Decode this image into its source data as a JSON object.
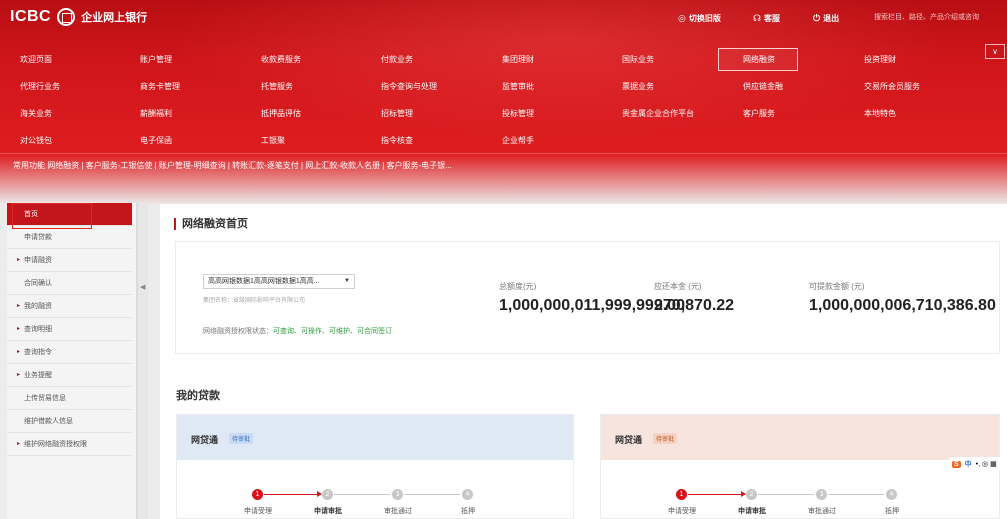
{
  "header": {
    "brand": "ICBC",
    "brand_sub": "企业网上银行",
    "switch_version": "切换旧版",
    "customer_service": "客服",
    "logout": "退出",
    "search_placeholder": "搜索栏目、路径、产品介绍或咨询"
  },
  "menu": [
    [
      "欢迎页面",
      "账户管理",
      "收款费服务",
      "付款业务",
      "集团理财",
      "国际业务",
      "网络融资",
      "投资理财"
    ],
    [
      "代理行业务",
      "商务卡管理",
      "托管服务",
      "指令查询与处理",
      "监管审批",
      "票据业务",
      "供应链金融",
      "交易所会员服务"
    ],
    [
      "海关业务",
      "薪酬福利",
      "抵押品评估",
      "招标管理",
      "投标管理",
      "贵金属企业合作平台",
      "客户服务",
      "本地特色"
    ],
    [
      "对公钱包",
      "电子保函",
      "工银聚",
      "指令核查",
      "企业帮手"
    ]
  ],
  "menu_toggle": "∨",
  "quickbar": "常用功能  网络融资 | 客户服务-工银信使 | 账户管理-明细查询 | 转账汇款-逐笔支付 | 网上汇款-收款人名册 | 客户服务-电子银...",
  "sidebar": {
    "items": [
      {
        "label": "首页",
        "active": true,
        "arrow": false
      },
      {
        "label": "申请贷款",
        "arrow": false
      },
      {
        "label": "申请融资",
        "arrow": true
      },
      {
        "label": "合同确认",
        "arrow": false
      },
      {
        "label": "我的融资",
        "arrow": true
      },
      {
        "label": "查询明细",
        "arrow": true
      },
      {
        "label": "查询指令",
        "arrow": true
      },
      {
        "label": "业务提醒",
        "arrow": true
      },
      {
        "label": "上传贸易信息",
        "arrow": false
      },
      {
        "label": "维护借款人信息",
        "arrow": false
      },
      {
        "label": "维护网络融资授权限",
        "arrow": true
      }
    ],
    "arrow_glyph": "▸"
  },
  "main": {
    "title": "网络融资首页",
    "account_select": "高高网银数据1高高网银数据1高高...",
    "group_name": "集团名称：省级国际影响平台有限公司",
    "auth_status_label": "网络融资授权限状态：",
    "auth_status_value": "可查询、可操作、可维护、可合同签订",
    "stats": [
      {
        "label": "总额度(元)",
        "value": "1,000,000,011,999,999.00"
      },
      {
        "label": "应还本金 (元)",
        "value": "270,870.22"
      },
      {
        "label": "可提款金额 (元)",
        "value": "1,000,000,006,710,386.80"
      }
    ],
    "loans_title": "我的贷款",
    "loans": [
      {
        "name": "网贷通",
        "badge": "待审批",
        "head_color": "#dee9f5",
        "badge_bg": "#c8dbf2",
        "badge_fg": "#3a6fb5"
      },
      {
        "name": "网贷通",
        "badge": "待审批",
        "head_color": "#f7e4de",
        "badge_bg": "#f6d2c4",
        "badge_fg": "#c0561d"
      }
    ],
    "steps": [
      "申请受理",
      "申请审批",
      "审批通过",
      "抵押"
    ]
  },
  "ime": {
    "logo": "S",
    "lang": "中",
    "tools": "•, ◎ ▦"
  }
}
